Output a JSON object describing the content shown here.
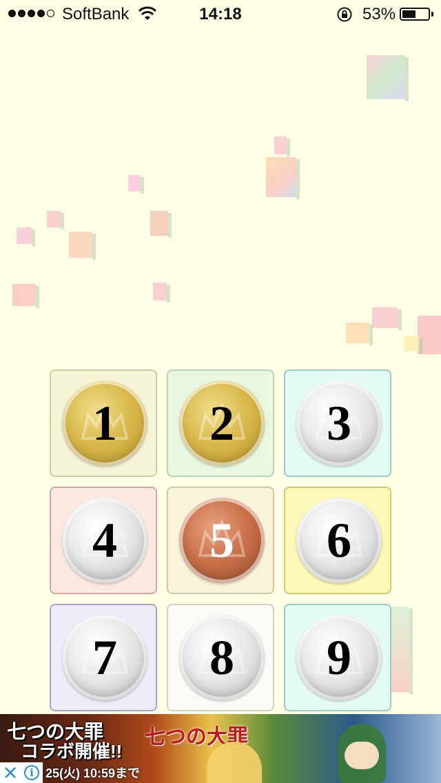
{
  "status_bar": {
    "carrier": "SoftBank",
    "time": "14:18",
    "battery_percent": "53%",
    "battery_level": 0.53,
    "signal_bars_filled": 4,
    "signal_bars_total": 5
  },
  "tiles": [
    {
      "number": "1",
      "coin": "gold",
      "tile_color": "#f6f4d6",
      "border_color": "#cfcba0"
    },
    {
      "number": "2",
      "coin": "gold",
      "tile_color": "#e8f7de",
      "border_color": "#b4d6b0"
    },
    {
      "number": "3",
      "coin": "silver",
      "tile_color": "#e4fbf4",
      "border_color": "#9acac4"
    },
    {
      "number": "4",
      "coin": "silver",
      "tile_color": "#fbe9e0",
      "border_color": "#cfa8a2"
    },
    {
      "number": "5",
      "coin": "bronze",
      "tile_color": "#f8f4d8",
      "border_color": "#cfcaa6"
    },
    {
      "number": "6",
      "coin": "silver",
      "tile_color": "#fcf8b8",
      "border_color": "#d2cb76"
    },
    {
      "number": "7",
      "coin": "silver",
      "tile_color": "#eeecf6",
      "border_color": "#a8a4c6"
    },
    {
      "number": "8",
      "coin": "silver",
      "tile_color": "#fbfbf6",
      "border_color": "#cfd0c8"
    },
    {
      "number": "9",
      "coin": "silver",
      "tile_color": "#e4fbf4",
      "border_color": "#9acac4"
    }
  ],
  "ad": {
    "headline_1": "七つの大罪",
    "headline_2": "コラボ開催!!",
    "date_text": "25(火) 10:59まで",
    "logo_text": "七つの大罪",
    "close_icon": "close-icon",
    "info_icon": "info-icon"
  },
  "colors": {
    "background": "#fffde3",
    "gold": "#d9b94c",
    "silver": "#e8e8e8",
    "bronze": "#c9714a"
  }
}
